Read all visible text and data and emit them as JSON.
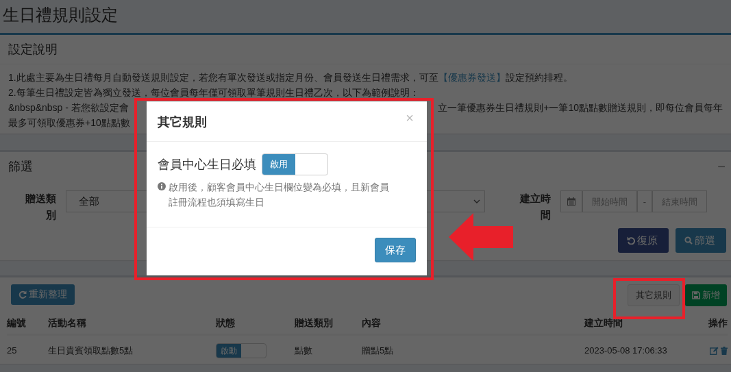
{
  "page": {
    "title": "生日禮規則設定"
  },
  "notes_box": {
    "title": "設定說明",
    "lines": [
      {
        "kind": "full",
        "segments": [
          {
            "kind": "text",
            "text": "1.此處主要為生日禮每月自動發送規則設定，若您有單次發送或指定月份、會員發送生日禮需求，可至"
          },
          {
            "kind": "link",
            "text": "【優惠券發送】"
          },
          {
            "kind": "text",
            "text": "設定預約排程。"
          }
        ]
      },
      {
        "kind": "full",
        "segments": [
          {
            "kind": "text",
            "text": "2.每筆生日禮設定皆為獨立發送，每位會員每年僅可領取單筆規則生日禮乙次，以下為範例說明："
          }
        ]
      },
      {
        "kind": "split",
        "left": "&nbsp&nbsp - 若您欲設定會",
        "right": "立一筆優惠券生日禮規則+一筆10點點數贈送規則，即每位會員每年"
      },
      {
        "kind": "split",
        "left": "最多可領取優惠券+10點點數"
      }
    ]
  },
  "filter_box": {
    "title": "篩選",
    "collapse": "−",
    "type_field": {
      "label": "贈送類別",
      "value": "全部"
    },
    "date_field": {
      "label": "建立時間",
      "start_placeholder": "開始時間",
      "separator": "-",
      "end_placeholder": "結束時間"
    },
    "buttons": [
      {
        "kind": "reset",
        "label": "復原"
      },
      {
        "kind": "filter",
        "label": "篩選"
      }
    ]
  },
  "list_box": {
    "toolbar": [
      {
        "kind": "refresh",
        "label": "重新整理"
      },
      {
        "kind": "other",
        "label": "其它規則"
      },
      {
        "kind": "add",
        "label": "新增"
      }
    ],
    "table": {
      "columns": [
        "編號",
        "活動名稱",
        "狀態",
        "贈送類別",
        "內容",
        "建立時間",
        "操作"
      ],
      "rows": [
        {
          "id": "25",
          "name": "生日貴賓領取點數5點",
          "status": {
            "label": "啟動",
            "on": true
          },
          "type": "點數",
          "content": "贈點5點",
          "created": "2023-05-08 17:06:33"
        }
      ]
    }
  },
  "modal": {
    "title": "其它規則",
    "close": "×",
    "setting": {
      "label": "會員中心生日必填",
      "toggle": {
        "label": "啟用",
        "on": true
      }
    },
    "help": "啟用後，顧客會員中心生日欄位變為必填，且新會員註冊流程也須填寫生日",
    "save": "保存"
  }
}
